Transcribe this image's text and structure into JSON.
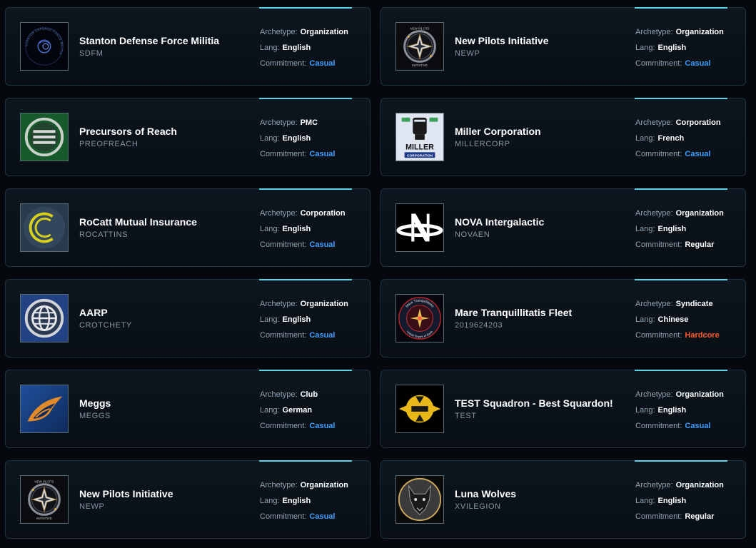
{
  "labels": {
    "archetype": "Archetype:",
    "lang": "Lang:",
    "commitment": "Commitment:"
  },
  "orgs": [
    {
      "name": "Stanton Defense Force Militia",
      "sid": "SDFM",
      "archetype": "Organization",
      "lang": "English",
      "commitment": "Casual",
      "logo_icon": "sdfm-logo",
      "logo_text": "STANTON DEFENSE FORCE MILITIA"
    },
    {
      "name": "New Pilots Initiative",
      "sid": "NEWP",
      "archetype": "Organization",
      "lang": "English",
      "commitment": "Casual",
      "logo_icon": "newp-star-logo",
      "logo_text_top": "NEW PILOTS",
      "logo_text_bottom": "INITIATIVE"
    },
    {
      "name": "Precursors of Reach",
      "sid": "PREOFREACH",
      "archetype": "PMC",
      "lang": "English",
      "commitment": "Casual",
      "logo_icon": "precursors-logo"
    },
    {
      "name": "Miller Corporation",
      "sid": "MILLERCORP",
      "archetype": "Corporation",
      "lang": "French",
      "commitment": "Casual",
      "logo_icon": "miller-fist-logo",
      "logo_text_top": "MILLER",
      "logo_text_bottom": "CORPORATION"
    },
    {
      "name": "RoCatt Mutual Insurance",
      "sid": "ROCATTINS",
      "archetype": "Corporation",
      "lang": "English",
      "commitment": "Casual",
      "logo_icon": "rocatt-logo"
    },
    {
      "name": "NOVA Intergalactic",
      "sid": "NOVAEN",
      "archetype": "Organization",
      "lang": "English",
      "commitment": "Regular",
      "logo_icon": "nova-logo"
    },
    {
      "name": "AARP",
      "sid": "CROTCHETY",
      "archetype": "Organization",
      "lang": "English",
      "commitment": "Casual",
      "logo_icon": "aarp-globe-logo"
    },
    {
      "name": "Mare Tranquillitatis Fleet",
      "sid": "2019624203",
      "archetype": "Syndicate",
      "lang": "Chinese",
      "commitment": "Hardcore",
      "logo_icon": "mare-tranquillitatis-logo",
      "logo_text_top": "Mare Tranquillitatis",
      "logo_text_bottom": "United Empire of Earth"
    },
    {
      "name": "Meggs",
      "sid": "MEGGS",
      "archetype": "Club",
      "lang": "German",
      "commitment": "Casual",
      "logo_icon": "meggs-wing-logo"
    },
    {
      "name": "TEST Squadron - Best Squardon!",
      "sid": "TEST",
      "archetype": "Organization",
      "lang": "English",
      "commitment": "Casual",
      "logo_icon": "test-squadron-logo"
    },
    {
      "name": "New Pilots Initiative",
      "sid": "NEWP",
      "archetype": "Organization",
      "lang": "English",
      "commitment": "Casual",
      "logo_icon": "newp-star-logo",
      "logo_text_top": "NEW PILOTS",
      "logo_text_bottom": "INITIATIVE"
    },
    {
      "name": "Luna Wolves",
      "sid": "XVILEGION",
      "archetype": "Organization",
      "lang": "English",
      "commitment": "Regular",
      "logo_icon": "wolf-logo"
    }
  ],
  "colors": {
    "accent": "#59d4e8",
    "casual": "#3d9eff",
    "hardcore": "#ff5a2a",
    "regular": "#ffffff"
  }
}
